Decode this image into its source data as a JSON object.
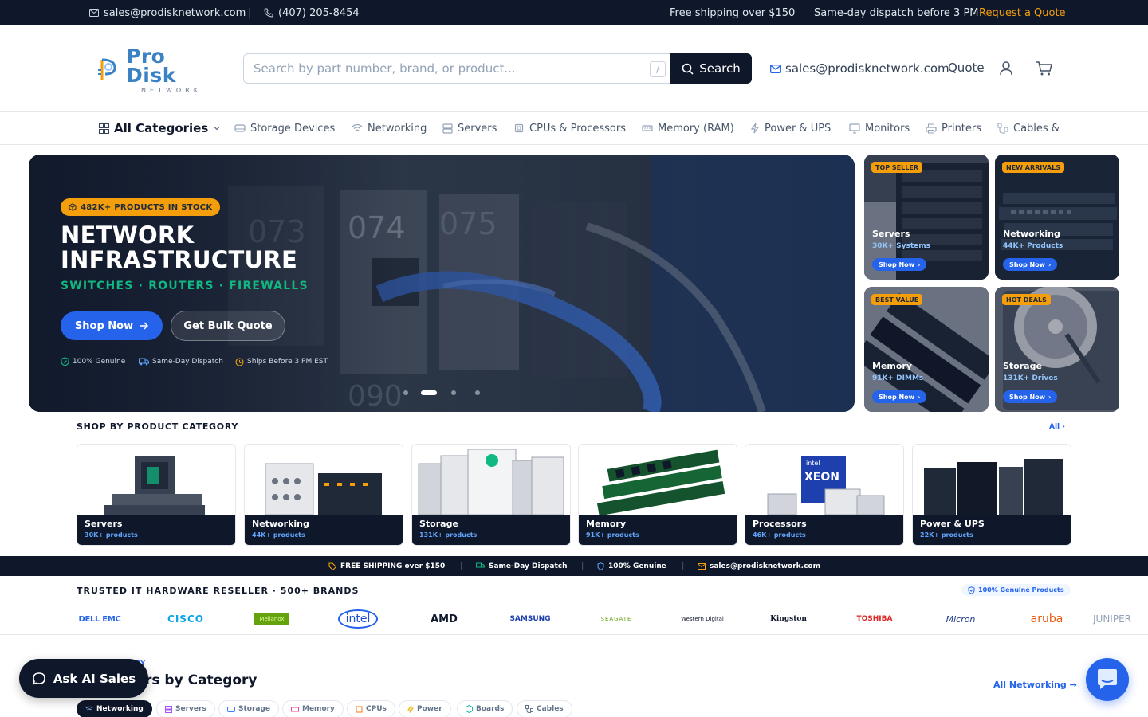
{
  "topbar": {
    "email": "sales@prodisknetwork.com",
    "phone": "(407) 205-8454",
    "free_shipping": "Free shipping over $150",
    "dispatch": "Same-day dispatch before 3 PM",
    "request_quote": "Request a Quote"
  },
  "logo": {
    "name": "Pro Disk",
    "tagline": "NETWORK"
  },
  "search": {
    "placeholder": "Search by part number, brand, or product...",
    "value": "",
    "shortcut": "/",
    "button_label": "Search"
  },
  "header": {
    "email": "sales@prodisknetwork.com",
    "quote_label": "Quote"
  },
  "categories_nav": {
    "all_label": "All Categories",
    "items": [
      "Storage Devices",
      "Networking",
      "Servers",
      "CPUs & Processors",
      "Memory (RAM)",
      "Power & UPS",
      "Monitors",
      "Printers",
      "Cables &"
    ]
  },
  "hero": {
    "badge": "482K+ PRODUCTS IN STOCK",
    "title_line1": "NETWORK",
    "title_line2": "INFRASTRUCTURE",
    "subtitle": "SWITCHES · ROUTERS · FIREWALLS",
    "shop_label": "Shop Now",
    "bulk_label": "Get Bulk Quote",
    "trust": [
      "100% Genuine",
      "Same-Day Dispatch",
      "Ships Before 3 PM EST"
    ],
    "slides_total": 4,
    "active_slide": 2,
    "background_labels": [
      "073",
      "074",
      "075",
      "090"
    ]
  },
  "promo_tiles": [
    {
      "ribbon": "TOP SELLER",
      "name": "Servers",
      "count": "30K+ Systems",
      "cta": "Shop Now"
    },
    {
      "ribbon": "NEW ARRIVALS",
      "name": "Networking",
      "count": "44K+ Products",
      "cta": "Shop Now"
    },
    {
      "ribbon": "BEST VALUE",
      "name": "Memory",
      "count": "91K+ DIMMs",
      "cta": "Shop Now"
    },
    {
      "ribbon": "HOT DEALS",
      "name": "Storage",
      "count": "131K+ Drives",
      "cta": "Shop Now"
    }
  ],
  "shop_by_category": {
    "title": "SHOP BY PRODUCT CATEGORY",
    "all_label": "All",
    "cards": [
      {
        "name": "Servers",
        "count": "30K+ products"
      },
      {
        "name": "Networking",
        "count": "44K+ products"
      },
      {
        "name": "Storage",
        "count": "131K+ products"
      },
      {
        "name": "Memory",
        "count": "91K+ products"
      },
      {
        "name": "Processors",
        "count": "46K+ products",
        "image_text": [
          "intel",
          "XEON"
        ]
      },
      {
        "name": "Power & UPS",
        "count": "22K+ products"
      }
    ]
  },
  "info_strip": [
    "FREE SHIPPING over $150",
    "Same-Day Dispatch",
    "100% Genuine",
    "sales@prodisknetwork.com"
  ],
  "brands": {
    "title": "TRUSTED IT HARDWARE RESELLER · 500+ BRANDS",
    "genuine_pill": "100% Genuine Products",
    "logos": [
      "DELL EMC",
      "CISCO",
      "Mellanox",
      "intel",
      "AMD",
      "SAMSUNG",
      "SEAGATE",
      "Western Digital",
      "Kingston",
      "TOSHIBA",
      "Micron",
      "aruba",
      "JUNIPER"
    ]
  },
  "bottom_section": {
    "eyebrow": "RY",
    "heading": "rs by Category",
    "all_label": "All Networking",
    "chips": [
      "Networking",
      "Servers",
      "Storage",
      "Memory",
      "CPUs",
      "Power",
      "Boards",
      "Cables"
    ],
    "active_chip": "Networking"
  },
  "ask_ai": {
    "label": "Ask AI Sales"
  },
  "colors": {
    "navy": "#0f172a",
    "accent_blue": "#2563eb",
    "amber": "#f59e0b",
    "green": "#10b981"
  }
}
